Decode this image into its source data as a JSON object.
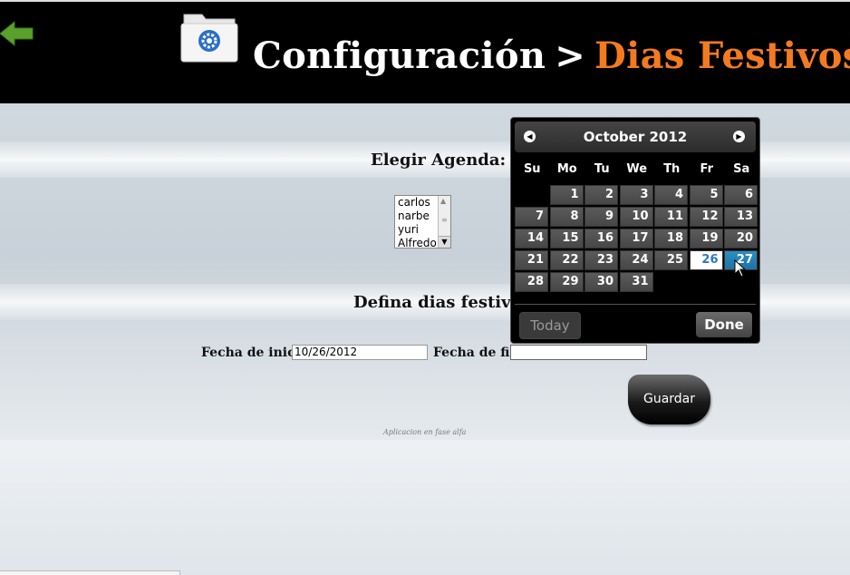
{
  "header": {
    "title_main": "Configuración",
    "title_separator": ">",
    "title_accent": "Dias Festivos",
    "accent_color": "#f47a20",
    "back_icon": "back-arrow-icon",
    "folder_icon": "settings-folder-icon"
  },
  "agenda": {
    "label": "Elegir Agenda:",
    "options": [
      "carlos",
      "narbe",
      "yuri",
      "Alfredo"
    ]
  },
  "holidays": {
    "label": "Defina dias festivos:",
    "start_label": "Fecha de inicio:",
    "start_value": "10/26/2012",
    "end_label": "Fecha de fin:",
    "end_value": ""
  },
  "save_button": "Guardar",
  "footer_note": "Aplicacion en fase alfa",
  "datepicker": {
    "month_year": "October 2012",
    "weekdays": [
      "Su",
      "Mo",
      "Tu",
      "We",
      "Th",
      "Fr",
      "Sa"
    ],
    "days": [
      "1",
      "2",
      "3",
      "4",
      "5",
      "6",
      "7",
      "8",
      "9",
      "10",
      "11",
      "12",
      "13",
      "14",
      "15",
      "16",
      "17",
      "18",
      "19",
      "20",
      "21",
      "22",
      "23",
      "24",
      "25",
      "26",
      "27",
      "28",
      "29",
      "30",
      "31"
    ],
    "first_weekday_index": 1,
    "selected_day": "26",
    "hover_day": "27",
    "today_label": "Today",
    "done_label": "Done",
    "selected_color": "#2a77c8",
    "hover_color": "#2a8fc4"
  }
}
